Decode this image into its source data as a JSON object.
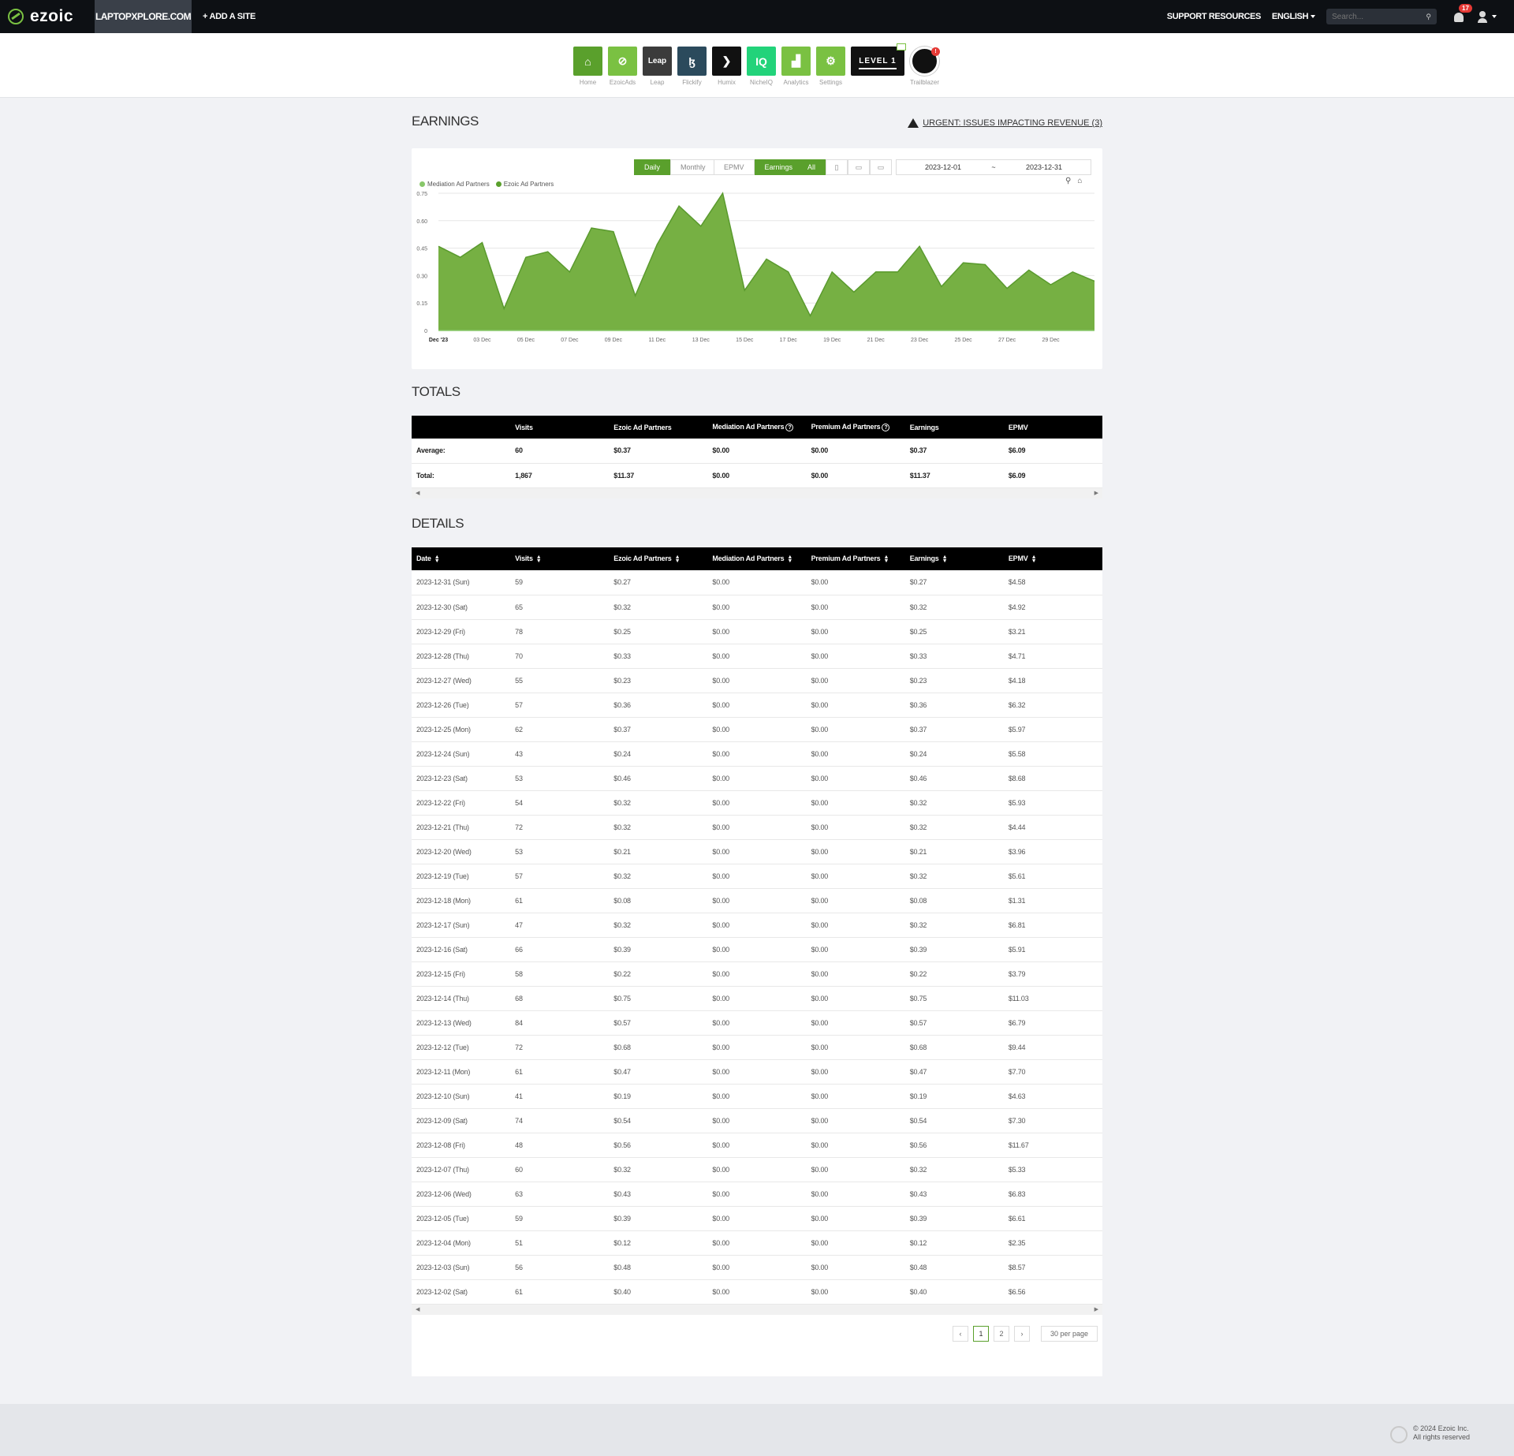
{
  "topbar": {
    "logo": "ezoic",
    "site": "LAPTOPXPLORE.COM",
    "add_site": "+ ADD A SITE",
    "support": "SUPPORT RESOURCES",
    "language": "ENGLISH",
    "search_placeholder": "Search...",
    "notifications": "17"
  },
  "nav": [
    {
      "label": "Home",
      "icon": "home-icon",
      "color": "#5aa02c",
      "glyph": "⌂"
    },
    {
      "label": "EzoicAds",
      "icon": "ezoicads-icon",
      "color": "#7ac142",
      "glyph": "⊘"
    },
    {
      "label": "Leap",
      "icon": "leap-icon",
      "color": "#3b3b3b",
      "glyph": "Leap"
    },
    {
      "label": "Flickify",
      "icon": "flickify-icon",
      "color": "#2b4a5c",
      "glyph": "ɮ"
    },
    {
      "label": "Humix",
      "icon": "humix-icon",
      "color": "#111111",
      "glyph": "❯"
    },
    {
      "label": "NicheIQ",
      "icon": "nicheiq-icon",
      "color": "#22d37a",
      "glyph": "IQ"
    },
    {
      "label": "Analytics",
      "icon": "analytics-icon",
      "color": "#7ac142",
      "glyph": "▟"
    },
    {
      "label": "Settings",
      "icon": "settings-icon",
      "color": "#7ac142",
      "glyph": "⚙"
    }
  ],
  "level_label": "LEVEL 1",
  "trailblazer_label": "Trailblazer",
  "earnings": {
    "title": "EARNINGS",
    "urgent": "URGENT: ISSUES IMPACTING REVENUE (3)",
    "buttons": {
      "daily": "Daily",
      "monthly": "Monthly",
      "epmv": "EPMV",
      "earnings": "Earnings",
      "all": "All"
    },
    "date_from": "2023-12-01",
    "date_sep": "~",
    "date_to": "2023-12-31"
  },
  "chart_data": {
    "type": "area",
    "series": [
      {
        "name": "Mediation Ad Partners",
        "values": [
          0,
          0,
          0,
          0,
          0,
          0,
          0,
          0,
          0,
          0,
          0,
          0,
          0,
          0,
          0,
          0,
          0,
          0,
          0,
          0,
          0,
          0,
          0,
          0,
          0,
          0,
          0,
          0,
          0,
          0,
          0
        ]
      },
      {
        "name": "Ezoic Ad Partners",
        "values": [
          0.46,
          0.4,
          0.48,
          0.12,
          0.4,
          0.43,
          0.32,
          0.56,
          0.54,
          0.19,
          0.47,
          0.68,
          0.57,
          0.75,
          0.22,
          0.39,
          0.32,
          0.08,
          0.32,
          0.21,
          0.32,
          0.32,
          0.46,
          0.24,
          0.37,
          0.36,
          0.23,
          0.33,
          0.25,
          0.32,
          0.27
        ]
      }
    ],
    "legend_colors": [
      "#88c76a",
      "#5aa02c"
    ],
    "area_color": "#76b043",
    "line_color": "#5a9a2e",
    "x_ticks": [
      "Dec '23",
      "03 Dec",
      "05 Dec",
      "07 Dec",
      "09 Dec",
      "11 Dec",
      "13 Dec",
      "15 Dec",
      "17 Dec",
      "19 Dec",
      "21 Dec",
      "23 Dec",
      "25 Dec",
      "27 Dec",
      "29 Dec"
    ],
    "y_ticks": [
      "0",
      "0.15",
      "0.30",
      "0.45",
      "0.60",
      "0.75"
    ],
    "ylim": [
      0,
      0.75
    ],
    "legend": "top-left",
    "grid": true
  },
  "totals": {
    "title": "TOTALS",
    "headers": [
      "",
      "Visits",
      "Ezoic Ad Partners",
      "Mediation Ad Partners",
      "Premium Ad Partners",
      "Earnings",
      "EPMV"
    ],
    "rows": [
      [
        "Average:",
        "60",
        "$0.37",
        "$0.00",
        "$0.00",
        "$0.37",
        "$6.09"
      ],
      [
        "Total:",
        "1,867",
        "$11.37",
        "$0.00",
        "$0.00",
        "$11.37",
        "$6.09"
      ]
    ]
  },
  "details": {
    "title": "DETAILS",
    "headers": [
      "Date",
      "Visits",
      "Ezoic Ad Partners",
      "Mediation Ad Partners",
      "Premium Ad Partners",
      "Earnings",
      "EPMV"
    ],
    "rows": [
      [
        "2023-12-31 (Sun)",
        "59",
        "$0.27",
        "$0.00",
        "$0.00",
        "$0.27",
        "$4.58"
      ],
      [
        "2023-12-30 (Sat)",
        "65",
        "$0.32",
        "$0.00",
        "$0.00",
        "$0.32",
        "$4.92"
      ],
      [
        "2023-12-29 (Fri)",
        "78",
        "$0.25",
        "$0.00",
        "$0.00",
        "$0.25",
        "$3.21"
      ],
      [
        "2023-12-28 (Thu)",
        "70",
        "$0.33",
        "$0.00",
        "$0.00",
        "$0.33",
        "$4.71"
      ],
      [
        "2023-12-27 (Wed)",
        "55",
        "$0.23",
        "$0.00",
        "$0.00",
        "$0.23",
        "$4.18"
      ],
      [
        "2023-12-26 (Tue)",
        "57",
        "$0.36",
        "$0.00",
        "$0.00",
        "$0.36",
        "$6.32"
      ],
      [
        "2023-12-25 (Mon)",
        "62",
        "$0.37",
        "$0.00",
        "$0.00",
        "$0.37",
        "$5.97"
      ],
      [
        "2023-12-24 (Sun)",
        "43",
        "$0.24",
        "$0.00",
        "$0.00",
        "$0.24",
        "$5.58"
      ],
      [
        "2023-12-23 (Sat)",
        "53",
        "$0.46",
        "$0.00",
        "$0.00",
        "$0.46",
        "$8.68"
      ],
      [
        "2023-12-22 (Fri)",
        "54",
        "$0.32",
        "$0.00",
        "$0.00",
        "$0.32",
        "$5.93"
      ],
      [
        "2023-12-21 (Thu)",
        "72",
        "$0.32",
        "$0.00",
        "$0.00",
        "$0.32",
        "$4.44"
      ],
      [
        "2023-12-20 (Wed)",
        "53",
        "$0.21",
        "$0.00",
        "$0.00",
        "$0.21",
        "$3.96"
      ],
      [
        "2023-12-19 (Tue)",
        "57",
        "$0.32",
        "$0.00",
        "$0.00",
        "$0.32",
        "$5.61"
      ],
      [
        "2023-12-18 (Mon)",
        "61",
        "$0.08",
        "$0.00",
        "$0.00",
        "$0.08",
        "$1.31"
      ],
      [
        "2023-12-17 (Sun)",
        "47",
        "$0.32",
        "$0.00",
        "$0.00",
        "$0.32",
        "$6.81"
      ],
      [
        "2023-12-16 (Sat)",
        "66",
        "$0.39",
        "$0.00",
        "$0.00",
        "$0.39",
        "$5.91"
      ],
      [
        "2023-12-15 (Fri)",
        "58",
        "$0.22",
        "$0.00",
        "$0.00",
        "$0.22",
        "$3.79"
      ],
      [
        "2023-12-14 (Thu)",
        "68",
        "$0.75",
        "$0.00",
        "$0.00",
        "$0.75",
        "$11.03"
      ],
      [
        "2023-12-13 (Wed)",
        "84",
        "$0.57",
        "$0.00",
        "$0.00",
        "$0.57",
        "$6.79"
      ],
      [
        "2023-12-12 (Tue)",
        "72",
        "$0.68",
        "$0.00",
        "$0.00",
        "$0.68",
        "$9.44"
      ],
      [
        "2023-12-11 (Mon)",
        "61",
        "$0.47",
        "$0.00",
        "$0.00",
        "$0.47",
        "$7.70"
      ],
      [
        "2023-12-10 (Sun)",
        "41",
        "$0.19",
        "$0.00",
        "$0.00",
        "$0.19",
        "$4.63"
      ],
      [
        "2023-12-09 (Sat)",
        "74",
        "$0.54",
        "$0.00",
        "$0.00",
        "$0.54",
        "$7.30"
      ],
      [
        "2023-12-08 (Fri)",
        "48",
        "$0.56",
        "$0.00",
        "$0.00",
        "$0.56",
        "$11.67"
      ],
      [
        "2023-12-07 (Thu)",
        "60",
        "$0.32",
        "$0.00",
        "$0.00",
        "$0.32",
        "$5.33"
      ],
      [
        "2023-12-06 (Wed)",
        "63",
        "$0.43",
        "$0.00",
        "$0.00",
        "$0.43",
        "$6.83"
      ],
      [
        "2023-12-05 (Tue)",
        "59",
        "$0.39",
        "$0.00",
        "$0.00",
        "$0.39",
        "$6.61"
      ],
      [
        "2023-12-04 (Mon)",
        "51",
        "$0.12",
        "$0.00",
        "$0.00",
        "$0.12",
        "$2.35"
      ],
      [
        "2023-12-03 (Sun)",
        "56",
        "$0.48",
        "$0.00",
        "$0.00",
        "$0.48",
        "$8.57"
      ],
      [
        "2023-12-02 (Sat)",
        "61",
        "$0.40",
        "$0.00",
        "$0.00",
        "$0.40",
        "$6.56"
      ]
    ]
  },
  "pagination": {
    "prev": "‹",
    "pages": [
      "1",
      "2"
    ],
    "next": "›",
    "per_page": "30 per page"
  },
  "footer": {
    "line1": "© 2024 Ezoic Inc.",
    "line2": "All rights reserved"
  }
}
